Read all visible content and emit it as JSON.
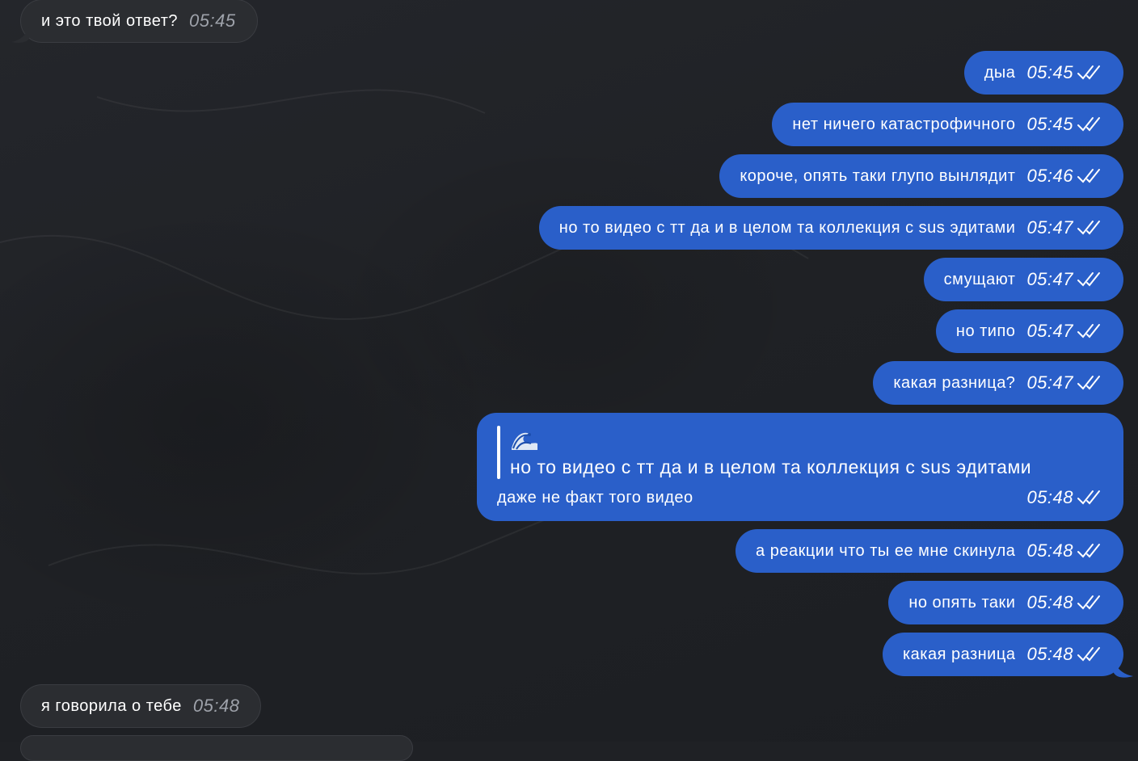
{
  "colors": {
    "background": "#1f2125",
    "incoming_bubble": "#2b2d31",
    "outgoing_bubble": "#2a5fc9",
    "incoming_time": "#9ea2aa",
    "text": "#ffffff"
  },
  "messages": [
    {
      "direction": "incoming",
      "text": "и это твой ответ?",
      "time": "05:45"
    },
    {
      "direction": "outgoing",
      "text": "дыа",
      "time": "05:45",
      "status": "read"
    },
    {
      "direction": "outgoing",
      "text": "нет ничего катастрофичного",
      "time": "05:45",
      "status": "read"
    },
    {
      "direction": "outgoing",
      "text": "короче, опять таки глупо вынлядит",
      "time": "05:46",
      "status": "read"
    },
    {
      "direction": "outgoing",
      "text": "но то видео с тт да и в целом та коллекция с sus эдитами",
      "time": "05:47",
      "status": "read"
    },
    {
      "direction": "outgoing",
      "text": "смущают",
      "time": "05:47",
      "status": "read"
    },
    {
      "direction": "outgoing",
      "text": "но типо",
      "time": "05:47",
      "status": "read"
    },
    {
      "direction": "outgoing",
      "text": "какая разница?",
      "time": "05:47",
      "status": "read"
    },
    {
      "direction": "outgoing",
      "quote": {
        "author_icon": "wave-emoji",
        "text": "но то видео с тт да и в целом та коллекция с sus эдитами"
      },
      "text": "даже не факт того видео",
      "time": "05:48",
      "status": "read"
    },
    {
      "direction": "outgoing",
      "text": "а реакции что ты ее мне скинула",
      "time": "05:48",
      "status": "read"
    },
    {
      "direction": "outgoing",
      "text": "но опять таки",
      "time": "05:48",
      "status": "read"
    },
    {
      "direction": "outgoing",
      "text": "какая разница",
      "time": "05:48",
      "status": "read"
    },
    {
      "direction": "incoming",
      "text": "я говорила о тебе",
      "time": "05:48"
    }
  ]
}
